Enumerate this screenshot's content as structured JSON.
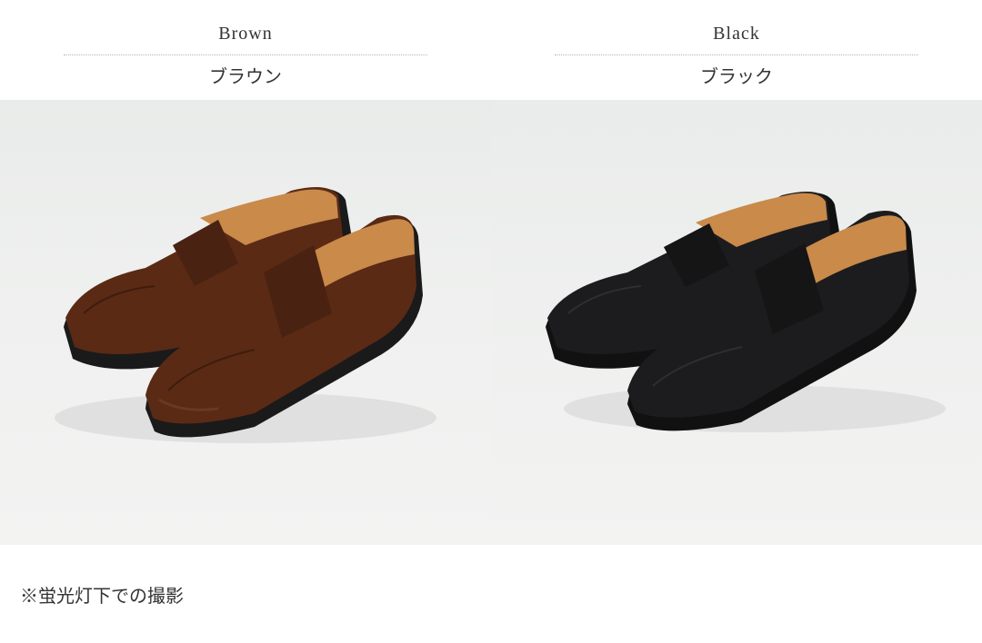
{
  "variants": [
    {
      "name_en": "Brown",
      "name_ja": "ブラウン",
      "color": "#5a2a15",
      "shadow": "#3e1c0d",
      "highlight": "#7a4228"
    },
    {
      "name_en": "Black",
      "name_ja": "ブラック",
      "color": "#1c1c1e",
      "shadow": "#0c0c0d",
      "highlight": "#2e2e31"
    }
  ],
  "colors": {
    "sole": "#1a1a1a",
    "lining": "#c98a4a",
    "background": "#eeefee"
  },
  "footer": {
    "note": "※蛍光灯下での撮影"
  }
}
